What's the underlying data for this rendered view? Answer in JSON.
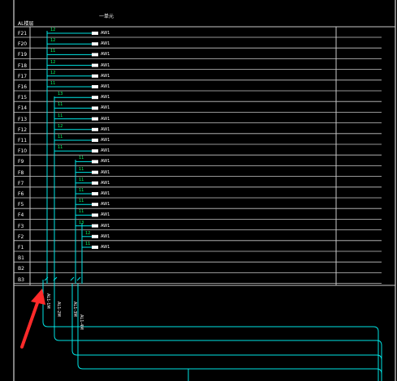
{
  "drawing": {
    "corner_label": "AL楼层",
    "unit_label": "一单元",
    "floors": [
      "F21",
      "F20",
      "F19",
      "F18",
      "F17",
      "F16",
      "F15",
      "F14",
      "F13",
      "F12",
      "F11",
      "F10",
      "F9",
      "F8",
      "F7",
      "F6",
      "F5",
      "F4",
      "F3",
      "F2",
      "F1",
      "B1",
      "B2",
      "B3"
    ],
    "branches": [
      {
        "floor": "F21",
        "cable": "12",
        "device": "AW1"
      },
      {
        "floor": "F20",
        "cable": "12",
        "device": "AW1"
      },
      {
        "floor": "F19",
        "cable": "11",
        "device": "AW1"
      },
      {
        "floor": "F18",
        "cable": "12",
        "device": "AW1"
      },
      {
        "floor": "F17",
        "cable": "12",
        "device": "AW1"
      },
      {
        "floor": "F16",
        "cable": "11",
        "device": "AW1"
      },
      {
        "floor": "F15",
        "cable": "13",
        "device": "AW1"
      },
      {
        "floor": "F14",
        "cable": "11",
        "device": "AW1"
      },
      {
        "floor": "F13",
        "cable": "11",
        "device": "AW1"
      },
      {
        "floor": "F12",
        "cable": "12",
        "device": "AW1"
      },
      {
        "floor": "F11",
        "cable": "11",
        "device": "AW1"
      },
      {
        "floor": "F10",
        "cable": "11",
        "device": "AW1"
      },
      {
        "floor": "F9",
        "cable": "11",
        "device": "AW1"
      },
      {
        "floor": "F8",
        "cable": "11",
        "device": "AW1"
      },
      {
        "floor": "F7",
        "cable": "11",
        "device": "AW1"
      },
      {
        "floor": "F6",
        "cable": "11",
        "device": "AW1"
      },
      {
        "floor": "F5",
        "cable": "11",
        "device": "AW1"
      },
      {
        "floor": "F4",
        "cable": "11",
        "device": "AW1"
      },
      {
        "floor": "F3",
        "cable": "13",
        "device": "AW1"
      },
      {
        "floor": "F2",
        "cable": "12",
        "device": "AW1"
      },
      {
        "floor": "F1",
        "cable": "11",
        "device": "AW1"
      }
    ],
    "riser_labels": [
      "AL1-1M",
      "AL1-2M",
      "AL1-3M",
      "AL1-4M"
    ],
    "bus_marks": [
      "1",
      "2",
      "3",
      "4"
    ]
  },
  "colors": {
    "background": "#000000",
    "frame": "#ffffff",
    "grid": "#c8c8c8",
    "wire": "#00e5e5",
    "cable_text": "#00ff66",
    "arrow": "#ff2a2a"
  }
}
